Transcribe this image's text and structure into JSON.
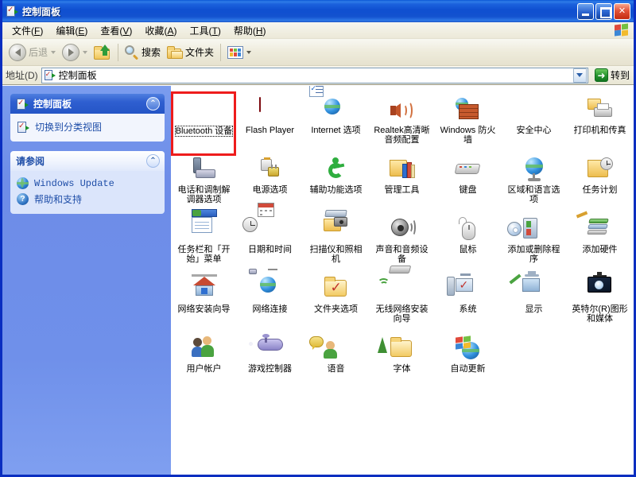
{
  "window": {
    "title": "控制面板",
    "title_icon": "control-panel-icon",
    "buttons": {
      "minimize": "_",
      "maximize": "□",
      "close": "✕"
    }
  },
  "menu": {
    "items": [
      {
        "label": "文件",
        "accel": "F"
      },
      {
        "label": "编辑",
        "accel": "E"
      },
      {
        "label": "查看",
        "accel": "V"
      },
      {
        "label": "收藏",
        "accel": "A"
      },
      {
        "label": "工具",
        "accel": "T"
      },
      {
        "label": "帮助",
        "accel": "H"
      }
    ]
  },
  "toolbar": {
    "back": "后退",
    "forward": "",
    "up": "",
    "search": "搜索",
    "folders": "文件夹",
    "views": ""
  },
  "address": {
    "label": "地址(D)",
    "value": "控制面板",
    "go_label": "转到"
  },
  "sidebar": {
    "panels": [
      {
        "title": "控制面板",
        "style": "dark",
        "tasks": [
          {
            "label": "切换到分类视图",
            "icon": "control-panel-switch-icon"
          }
        ]
      },
      {
        "title": "请参阅",
        "style": "light",
        "tasks": [
          {
            "label": "Windows Update",
            "icon": "windows-update-icon"
          },
          {
            "label": "帮助和支持",
            "icon": "help-and-support-icon"
          }
        ]
      }
    ]
  },
  "main": {
    "selected_item": "Bluetooth 设备",
    "selection_highlight_color": "#ee1c1c",
    "items": [
      {
        "label": "Bluetooth 设备",
        "icon": "bluetooth-icon",
        "glyph": "g-bt",
        "selected": true
      },
      {
        "label": "Flash Player",
        "icon": "flash-player-icon",
        "glyph": "g-flash",
        "selected": false
      },
      {
        "label": "Internet 选项",
        "icon": "internet-options-icon",
        "glyph": "g-ie",
        "selected": false
      },
      {
        "label": "Realtek高清晰音频配置",
        "icon": "realtek-audio-icon",
        "glyph": "g-spk",
        "selected": false
      },
      {
        "label": "Windows 防火墙",
        "icon": "windows-firewall-icon",
        "glyph": "g-fw",
        "selected": false
      },
      {
        "label": "安全中心",
        "icon": "security-center-icon",
        "glyph": "g-shield",
        "selected": false
      },
      {
        "label": "打印机和传真",
        "icon": "printers-and-faxes-icon",
        "glyph": "g-print",
        "selected": false
      },
      {
        "label": "电话和调制解调器选项",
        "icon": "phone-and-modem-icon",
        "glyph": "g-phone",
        "selected": false
      },
      {
        "label": "电源选项",
        "icon": "power-options-icon",
        "glyph": "g-pwr",
        "selected": false
      },
      {
        "label": "辅助功能选项",
        "icon": "accessibility-options-icon",
        "glyph": "g-acc",
        "selected": false
      },
      {
        "label": "管理工具",
        "icon": "administrative-tools-icon",
        "glyph": "g-admin",
        "selected": false
      },
      {
        "label": "键盘",
        "icon": "keyboard-icon",
        "glyph": "g-kbd",
        "selected": false
      },
      {
        "label": "区域和语言选项",
        "icon": "regional-and-language-icon",
        "glyph": "g-globe2",
        "selected": false
      },
      {
        "label": "任务计划",
        "icon": "scheduled-tasks-icon",
        "glyph": "g-task",
        "selected": false
      },
      {
        "label": "任务栏和「开始」菜单",
        "icon": "taskbar-and-start-menu-icon",
        "glyph": "g-bar",
        "selected": false
      },
      {
        "label": "日期和时间",
        "icon": "date-and-time-icon",
        "glyph": "g-date",
        "selected": false
      },
      {
        "label": "扫描仪和照相机",
        "icon": "scanners-and-cameras-icon",
        "glyph": "g-scan",
        "selected": false
      },
      {
        "label": "声音和音频设备",
        "icon": "sounds-and-audio-devices-icon",
        "glyph": "g-sound",
        "selected": false
      },
      {
        "label": "鼠标",
        "icon": "mouse-icon",
        "glyph": "g-mouse",
        "selected": false
      },
      {
        "label": "添加或删除程序",
        "icon": "add-remove-programs-icon",
        "glyph": "g-addrem",
        "selected": false
      },
      {
        "label": "添加硬件",
        "icon": "add-hardware-icon",
        "glyph": "g-addhw",
        "selected": false
      },
      {
        "label": "网络安装向导",
        "icon": "network-setup-wizard-icon",
        "glyph": "g-home",
        "selected": false
      },
      {
        "label": "网络连接",
        "icon": "network-connections-icon",
        "glyph": "g-netcon",
        "selected": false
      },
      {
        "label": "文件夹选项",
        "icon": "folder-options-icon",
        "glyph": "g-fldopt",
        "selected": false
      },
      {
        "label": "无线网络安装向导",
        "icon": "wireless-network-setup-icon",
        "glyph": "g-wifi",
        "selected": false
      },
      {
        "label": "系统",
        "icon": "system-icon",
        "glyph": "g-sys",
        "selected": false
      },
      {
        "label": "显示",
        "icon": "display-icon",
        "glyph": "g-disp",
        "selected": false
      },
      {
        "label": "英特尔(R)图形和媒体",
        "icon": "intel-graphics-and-media-icon",
        "glyph": "g-intel",
        "selected": false
      },
      {
        "label": "用户帐户",
        "icon": "user-accounts-icon",
        "glyph": "g-users",
        "selected": false
      },
      {
        "label": "游戏控制器",
        "icon": "game-controllers-icon",
        "glyph": "g-game",
        "selected": false
      },
      {
        "label": "语音",
        "icon": "speech-icon",
        "glyph": "g-speech",
        "selected": false
      },
      {
        "label": "字体",
        "icon": "fonts-icon",
        "glyph": "g-fonts",
        "selected": false
      },
      {
        "label": "自动更新",
        "icon": "automatic-updates-icon",
        "glyph": "g-auto",
        "selected": false
      }
    ]
  }
}
